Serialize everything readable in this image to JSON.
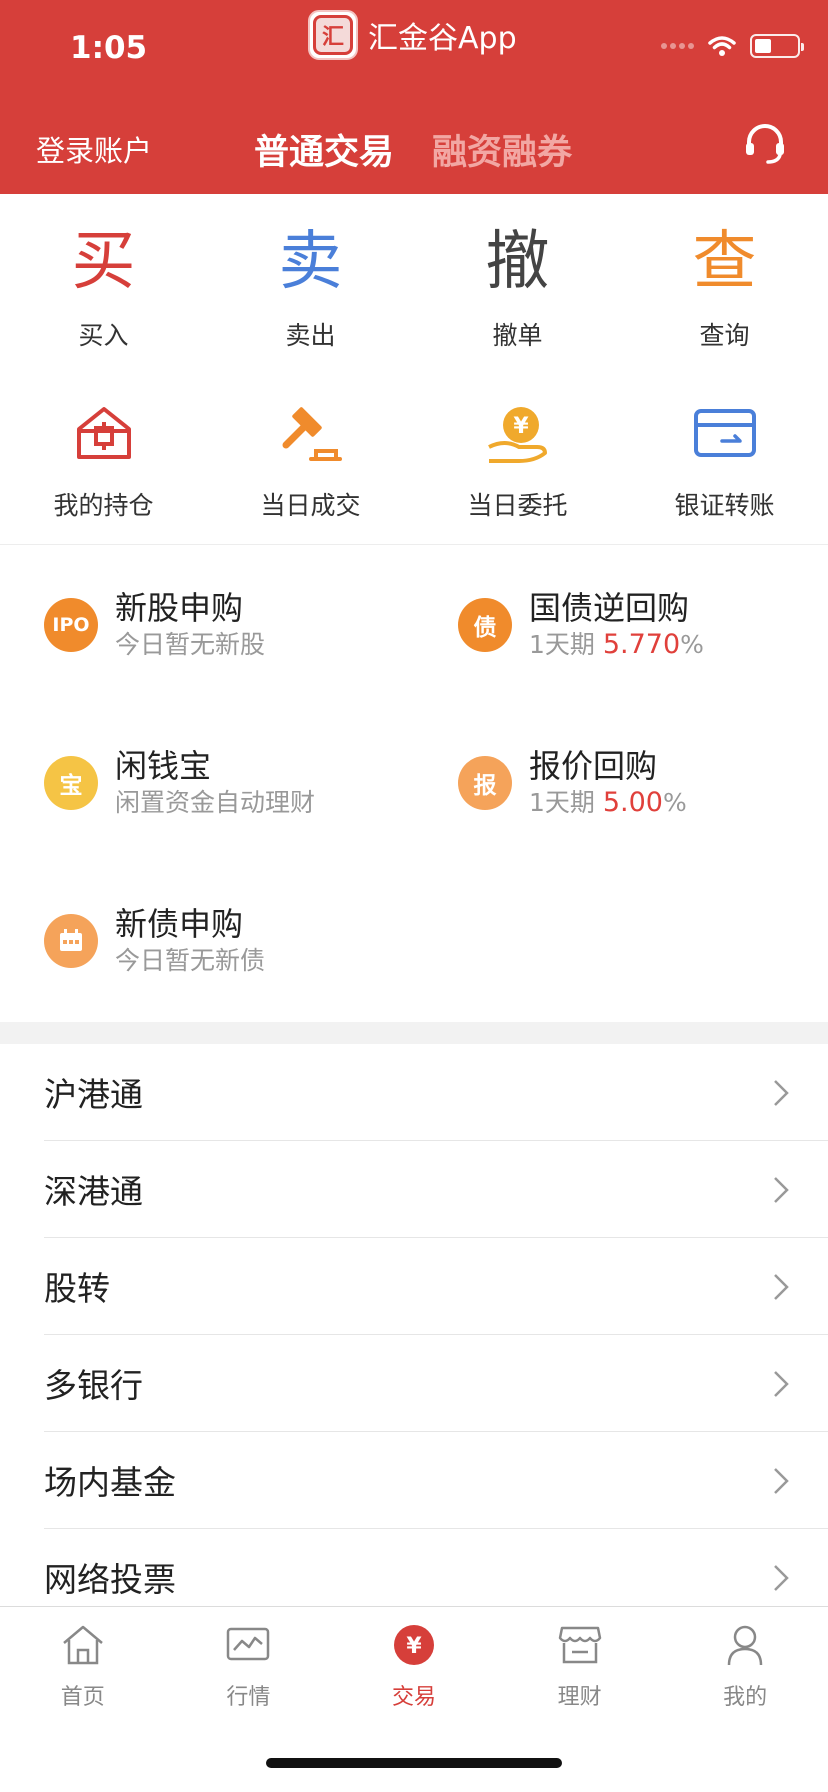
{
  "status_bar": {
    "time": "1:05",
    "app_name": "汇金谷App",
    "app_logo_text": "汇"
  },
  "header": {
    "login_label": "登录账户",
    "tabs": [
      {
        "label": "普通交易",
        "active": true
      },
      {
        "label": "融资融券",
        "active": false
      }
    ],
    "service_icon": "headset-icon"
  },
  "actions": [
    {
      "char": "买",
      "label": "买入",
      "color": "#d63f3a"
    },
    {
      "char": "卖",
      "label": "卖出",
      "color": "#4a7fd9"
    },
    {
      "char": "撤",
      "label": "撤单",
      "color": "#444444"
    },
    {
      "char": "查",
      "label": "查询",
      "color": "#f08b2c"
    }
  ],
  "features": [
    {
      "label": "我的持仓",
      "icon": "position-icon",
      "color": "#d63f3a"
    },
    {
      "label": "当日成交",
      "icon": "gavel-icon",
      "color": "#f08b2c"
    },
    {
      "label": "当日委托",
      "icon": "yen-hand-icon",
      "color": "#f0a92c"
    },
    {
      "label": "银证转账",
      "icon": "transfer-card-icon",
      "color": "#4a7fd9"
    }
  ],
  "services": [
    {
      "badge": "IPO",
      "title": "新股申购",
      "subtitle": "今日暂无新股",
      "color": "#f08b2c"
    },
    {
      "badge": "债",
      "title": "国债逆回购",
      "period": "1天期",
      "rate": "5.770",
      "unit": "%",
      "color": "#f08b2c"
    },
    {
      "badge": "宝",
      "title": "闲钱宝",
      "subtitle": "闲置资金自动理财",
      "color": "#f5c445"
    },
    {
      "badge": "报",
      "title": "报价回购",
      "period": "1天期",
      "rate": "5.00",
      "unit": "%",
      "color": "#f5a35a"
    },
    {
      "badge": "calendar",
      "title": "新债申购",
      "subtitle": "今日暂无新债",
      "color": "#f5a35a"
    }
  ],
  "list": [
    "沪港通",
    "深港通",
    "股转",
    "多银行",
    "场内基金",
    "网络投票"
  ],
  "tabbar": [
    {
      "label": "首页",
      "icon": "home-icon",
      "active": false
    },
    {
      "label": "行情",
      "icon": "chart-icon",
      "active": false
    },
    {
      "label": "交易",
      "icon": "yen-circle-icon",
      "active": true
    },
    {
      "label": "理财",
      "icon": "shop-icon",
      "active": false
    },
    {
      "label": "我的",
      "icon": "user-icon",
      "active": false
    }
  ],
  "colors": {
    "brand": "#d63f3a",
    "header_bg": "#d63f3a",
    "inactive_tab": "#f2a7a3",
    "rate": "#e0403b"
  }
}
